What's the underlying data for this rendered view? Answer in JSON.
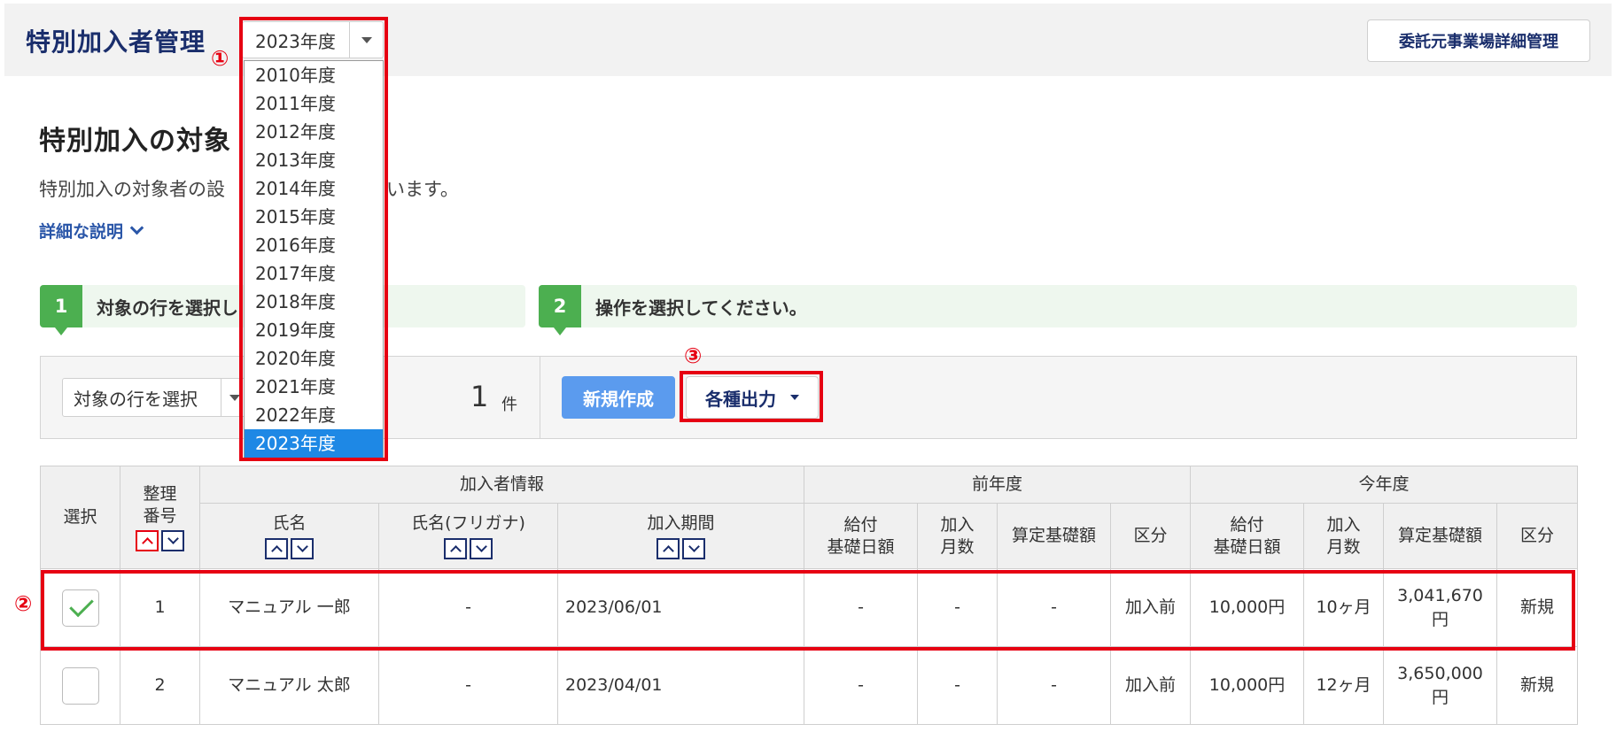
{
  "header": {
    "title": "特別加入者管理",
    "detail_button": "委託元事業場詳細管理"
  },
  "year_select": {
    "value": "2023年度",
    "options": [
      "2010年度",
      "2011年度",
      "2012年度",
      "2013年度",
      "2014年度",
      "2015年度",
      "2016年度",
      "2017年度",
      "2018年度",
      "2019年度",
      "2020年度",
      "2021年度",
      "2022年度",
      "2023年度"
    ],
    "selected_index": 13
  },
  "badges": {
    "b1": "①",
    "b2": "②",
    "b3": "③"
  },
  "section": {
    "title": "特別加入の対象",
    "desc": "特別加入の対象者の設",
    "desc_tail": "います。",
    "detail_link": "詳細な説明"
  },
  "steps": [
    {
      "num": "1",
      "label": "対象の行を選択し"
    },
    {
      "num": "2",
      "label": "操作を選択してください。"
    }
  ],
  "toolbar": {
    "row_select": "対象の行を選択",
    "count": "1",
    "count_unit": "件",
    "new_button": "新規作成",
    "output_button": "各種出力"
  },
  "table": {
    "headers": {
      "select": "選択",
      "seq": "整理\n番号",
      "member_info": "加入者情報",
      "prev_year": "前年度",
      "this_year": "今年度",
      "name": "氏名",
      "kana": "氏名(フリガナ)",
      "period": "加入期間",
      "prev_daily": "給付\n基礎日額",
      "prev_months": "加入\n月数",
      "prev_base": "算定基礎額",
      "prev_category": "区分",
      "cur_daily": "給付\n基礎日額",
      "cur_months": "加入\n月数",
      "cur_base": "算定基礎額",
      "cur_category": "区分"
    },
    "rows": [
      {
        "checked": true,
        "seq": "1",
        "name": "マニュアル 一郎",
        "kana": "-",
        "period": "2023/06/01",
        "prev_daily": "-",
        "prev_months": "-",
        "prev_base": "-",
        "prev_category": "加入前",
        "cur_daily": "10,000円",
        "cur_months": "10ヶ月",
        "cur_base": "3,041,670\n円",
        "cur_category": "新規"
      },
      {
        "checked": false,
        "seq": "2",
        "name": "マニュアル 太郎",
        "kana": "-",
        "period": "2023/04/01",
        "prev_daily": "-",
        "prev_months": "-",
        "prev_base": "-",
        "prev_category": "加入前",
        "cur_daily": "10,000円",
        "cur_months": "12ヶ月",
        "cur_base": "3,650,000\n円",
        "cur_category": "新規"
      }
    ]
  },
  "colors": {
    "accent": "#1a2e6c",
    "highlight": "#e60012",
    "step": "#4caf50",
    "primary_button": "#5b9bee",
    "selected_option": "#1e88e5"
  }
}
